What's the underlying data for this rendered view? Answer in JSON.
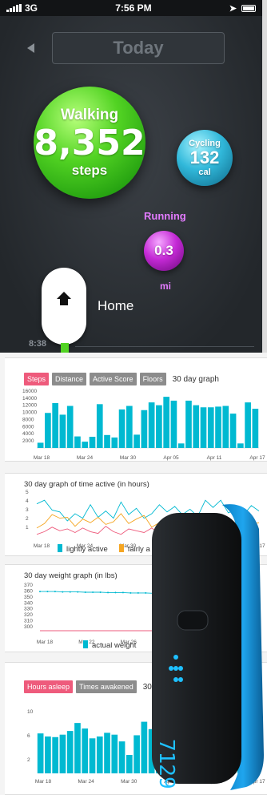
{
  "status_bar": {
    "carrier": "3G",
    "time": "7:56 PM"
  },
  "phone": {
    "header_title": "Today",
    "walking": {
      "label": "Walking",
      "value": "8,352",
      "unit": "steps"
    },
    "cycling": {
      "label": "Cycling",
      "value": "132",
      "unit": "cal"
    },
    "running": {
      "label": "Running",
      "value": "0.3",
      "unit": "mi"
    },
    "location": "Home",
    "timeline_time": "8:38"
  },
  "steps_card": {
    "tabs": [
      "Steps",
      "Distance",
      "Active Score",
      "Floors"
    ],
    "active_tab": "Steps",
    "graph_label": "30 day graph"
  },
  "active_card": {
    "title": "30 day graph of time active (in hours)",
    "legend": [
      "lightly active",
      "fairly a"
    ]
  },
  "weight_card": {
    "title": "30 day weight graph (in lbs)",
    "legend": [
      "actual weight"
    ]
  },
  "sleep_card": {
    "tabs": [
      "Hours asleep",
      "Times awakened"
    ],
    "active_tab": "Hours asleep",
    "graph_label": "30 d"
  },
  "colors": {
    "teal": "#00b9d1",
    "pink": "#ee5b7c",
    "orange": "#f5a623",
    "green": "#52d323",
    "purple": "#c52ad6"
  },
  "chart_data": [
    {
      "type": "bar",
      "title": "30 day graph",
      "ylim": [
        0,
        16000
      ],
      "y_ticks": [
        "16000",
        "14000",
        "12000",
        "10000",
        "8000",
        "6000",
        "4000",
        "2000"
      ],
      "x_tick_labels": [
        "Mar 18",
        "Mar 24",
        "Mar 30",
        "Apr 05",
        "Apr 11",
        "Apr 17"
      ],
      "series": [
        {
          "values": [
            1500,
            10000,
            12800,
            9500,
            12000,
            3300,
            1800,
            3200,
            12500,
            3700,
            3000,
            11000,
            12000,
            3800,
            10800,
            13000,
            12200,
            14600,
            13500,
            1300,
            13500,
            12200,
            11600,
            11600,
            11800,
            12000,
            9800,
            1300,
            13000,
            11200
          ]
        }
      ]
    },
    {
      "type": "line",
      "title": "30 day graph of time active (in hours)",
      "ylim": [
        0,
        5
      ],
      "y_ticks": [
        "5",
        "4",
        "3",
        "2",
        "1"
      ],
      "x_tick_labels": [
        "Mar 18",
        "Mar 24",
        "Mar 30",
        "Apr 05",
        "Apr 11",
        "Apr 17"
      ],
      "series": [
        {
          "name": "lightly active",
          "values": [
            3.6,
            4.0,
            2.9,
            2.7,
            1.7,
            2.5,
            2.0,
            3.5,
            2.1,
            2.8,
            2.0,
            3.8,
            2.4,
            3.1,
            2.0,
            2.5,
            3.5,
            2.7,
            3.3,
            2.4,
            3.0,
            2.2,
            4.0,
            3.2,
            4.0,
            2.6,
            3.0,
            2.4,
            3.4,
            2.8
          ]
        },
        {
          "name": "fairly a",
          "values": [
            0.9,
            1.4,
            2.4,
            2.0,
            2.1,
            1.1,
            1.9,
            1.5,
            2.1,
            1.3,
            1.6,
            2.5,
            1.4,
            1.9,
            2.3,
            1.0,
            1.5,
            1.8,
            1.3,
            1.5,
            1.9,
            1.6,
            1.2,
            1.8,
            1.5,
            2.0,
            1.4,
            1.6,
            1.3,
            1.5
          ]
        },
        {
          "values": [
            0.2,
            0.5,
            1.0,
            0.6,
            0.8,
            0.4,
            0.9,
            0.5,
            0.3,
            1.1,
            0.5,
            0.2,
            0.8,
            0.6,
            0.4,
            0.9,
            0.3,
            0.7,
            0.5,
            0.4,
            0.6,
            0.5,
            0.4,
            0.6,
            0.5,
            0.5,
            0.4,
            0.6,
            0.5,
            0.5
          ]
        }
      ]
    },
    {
      "type": "line",
      "title": "30 day weight graph (in lbs)",
      "ylim": [
        300,
        370
      ],
      "y_ticks": [
        "370",
        "360",
        "350",
        "340",
        "330",
        "320",
        "310",
        "300"
      ],
      "x_tick_labels": [
        "Mar 18",
        "Mar 22",
        "Mar 26",
        "Mar 30",
        "A",
        "15"
      ],
      "series": [
        {
          "name": "actual weight",
          "values": [
            357,
            357,
            357,
            356.5,
            356.5,
            356.5,
            356,
            356,
            356,
            355.5,
            355.5,
            355.5,
            355,
            355,
            355,
            354.5,
            354.5,
            354.5,
            354,
            354,
            354,
            353.5,
            353.5,
            353.5,
            353,
            353,
            353,
            352.5,
            352.5,
            352
          ]
        },
        {
          "values": [
            300,
            300
          ]
        }
      ]
    },
    {
      "type": "bar",
      "title": "30 d",
      "ylim": [
        0,
        12
      ],
      "y_ticks": [
        "10",
        "6",
        "2"
      ],
      "x_tick_labels": [
        "Mar 18",
        "Mar 24",
        "Mar 30",
        "Apr 05",
        "Apr 11",
        "Apr 17"
      ],
      "series": [
        {
          "values": [
            6.5,
            6.0,
            5.9,
            6.3,
            6.9,
            8.2,
            7.3,
            5.7,
            6.0,
            6.6,
            6.3,
            5.2,
            3.0,
            6.2,
            8.4,
            7.2,
            6.5,
            6.2,
            7.5,
            6.9,
            5.8,
            6.6,
            7.0,
            6.4,
            6.5,
            7.6,
            8.5,
            6.9,
            6.6,
            6.0
          ]
        }
      ]
    }
  ]
}
